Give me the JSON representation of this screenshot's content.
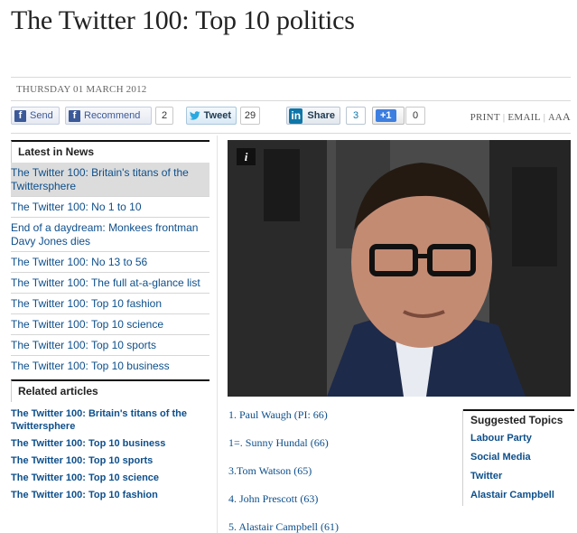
{
  "headline": "The Twitter 100: Top 10 politics",
  "dateline": "THURSDAY 01 MARCH 2012",
  "share": {
    "send": "Send",
    "recommend": "Recommend",
    "recommend_count": "2",
    "tweet": "Tweet",
    "tweet_count": "29",
    "linkedin": "Share",
    "linkedin_count": "3",
    "plusone": "+1",
    "plusone_count": "0"
  },
  "tools": {
    "print": "PRINT",
    "email": "EMAIL",
    "a_small": "A",
    "a_medium": "A",
    "a_large": "A"
  },
  "latest_news": {
    "heading": "Latest in News",
    "items": [
      "The Twitter 100: Britain's titans of the Twittersphere",
      "The Twitter 100: No 1 to 10",
      "End of a daydream: Monkees frontman Davy Jones dies",
      "The Twitter 100: No 13 to 56",
      "The Twitter 100: The full at-a-glance list",
      "The Twitter 100: Top 10 fashion",
      "The Twitter 100: Top 10 science",
      "The Twitter 100: Top 10 sports",
      "The Twitter 100: Top 10 business"
    ]
  },
  "related": {
    "heading": "Related articles",
    "items": [
      "The Twitter 100: Britain's titans of the Twittersphere",
      "The Twitter 100: Top 10 business",
      "The Twitter 100: Top 10 sports",
      "The Twitter 100: Top 10 science",
      "The Twitter 100: Top 10 fashion"
    ]
  },
  "photo": {
    "info_label": "i",
    "icon": "info-icon"
  },
  "rankings": [
    "1. Paul Waugh (PI: 66)",
    "1=. Sunny Hundal (66)",
    "3.Tom Watson (65)",
    "4. John Prescott (63)",
    "5. Alastair Campbell (61)"
  ],
  "suggested_topics": {
    "heading": "Suggested Topics",
    "items": [
      "Labour Party",
      "Social Media",
      "Twitter",
      "Alastair Campbell"
    ]
  },
  "colors": {
    "link": "#0d4f8b",
    "facebook": "#3b5998",
    "linkedin": "#0e76a8",
    "google": "#3d7fe0"
  }
}
